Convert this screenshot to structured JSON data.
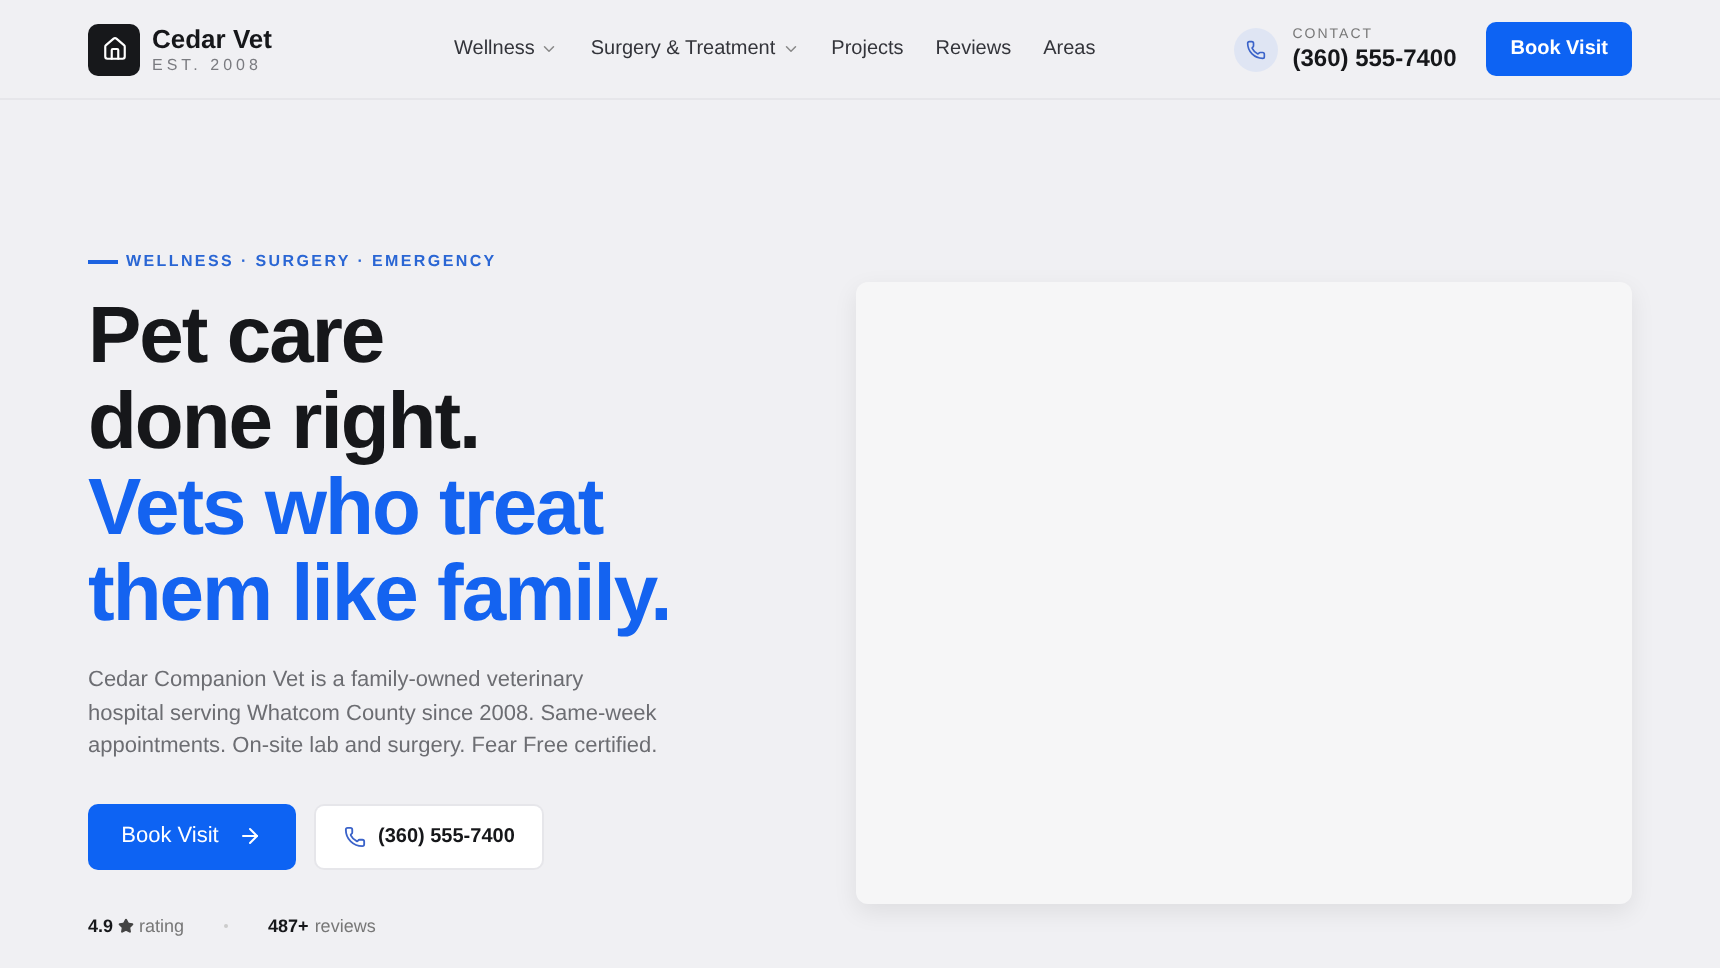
{
  "brand": {
    "name": "Cedar Vet",
    "tagline": "EST. 2008"
  },
  "nav": [
    {
      "label": "Wellness",
      "dropdown": true
    },
    {
      "label": "Surgery & Treatment",
      "dropdown": true
    },
    {
      "label": "Projects",
      "dropdown": false
    },
    {
      "label": "Reviews",
      "dropdown": false
    },
    {
      "label": "Areas",
      "dropdown": false
    }
  ],
  "contact": {
    "label": "CONTACT",
    "phone": "(360) 555-7400"
  },
  "header_button": "Book Visit",
  "hero": {
    "eyebrow": "WELLNESS · SURGERY · EMERGENCY",
    "headline_lines": [
      "Pet care",
      "done right."
    ],
    "accent_lines": [
      "Vets who treat",
      "them like family."
    ],
    "body": "Cedar Companion Vet is a family-owned veterinary hospital serving Whatcom County since 2008. Same-week appointments. On-site lab and surgery. Fear Free certified.",
    "primary_button": "Book Visit",
    "phone_button": "(360) 555-7400",
    "stats": [
      {
        "kind": "rating",
        "value": "4.9",
        "label": "rating"
      },
      {
        "kind": "count",
        "value": "487+",
        "label": "reviews"
      }
    ]
  }
}
